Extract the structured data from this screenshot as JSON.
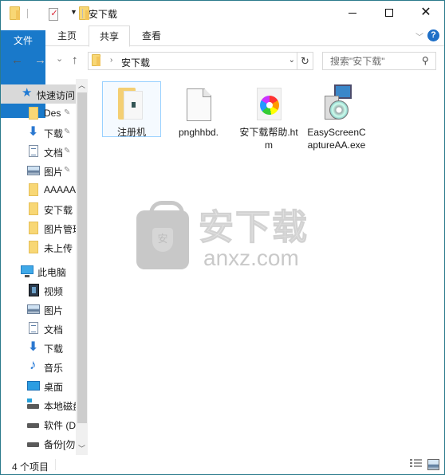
{
  "window": {
    "title": "安下载",
    "controls": {
      "minimize": "minimize",
      "maximize": "maximize",
      "close": "close"
    }
  },
  "quick_access_toolbar": {
    "icons": [
      "folder-icon",
      "properties-icon",
      "new-folder-icon",
      "customize-dropdown-icon"
    ]
  },
  "ribbon": {
    "tabs": [
      {
        "label": "文件"
      },
      {
        "label": "主页"
      },
      {
        "label": "共享",
        "active": true
      },
      {
        "label": "查看"
      }
    ],
    "expand_glyph": "﹀",
    "help_glyph": "?"
  },
  "navigation": {
    "back": "←",
    "forward": "→",
    "recent": "⌄",
    "up": "↑",
    "address": {
      "separator": "›",
      "crumbs": [
        "安下载"
      ],
      "dropdown": "⌄",
      "refresh": "↻"
    },
    "search": {
      "placeholder": "搜索\"安下载\"",
      "value": "",
      "icon": "⚲"
    }
  },
  "sidebar": {
    "quick_access_label": "快速访问",
    "items": [
      {
        "label": "快速访问",
        "icon": "star",
        "group": "header",
        "selected": true
      },
      {
        "label": "Des",
        "icon": "folder",
        "pinned": true
      },
      {
        "label": "下载",
        "icon": "download",
        "pinned": true
      },
      {
        "label": "文档",
        "icon": "document",
        "pinned": true
      },
      {
        "label": "图片",
        "icon": "picture",
        "pinned": true
      },
      {
        "label": "AAAAA",
        "icon": "folder"
      },
      {
        "label": "安下载",
        "icon": "folder"
      },
      {
        "label": "图片管理",
        "icon": "folder"
      },
      {
        "label": "未上传",
        "icon": "folder"
      },
      {
        "label": "此电脑",
        "icon": "computer",
        "group": "header"
      },
      {
        "label": "视频",
        "icon": "video"
      },
      {
        "label": "图片",
        "icon": "picture"
      },
      {
        "label": "文档",
        "icon": "document"
      },
      {
        "label": "下载",
        "icon": "download"
      },
      {
        "label": "音乐",
        "icon": "music"
      },
      {
        "label": "桌面",
        "icon": "desktop"
      },
      {
        "label": "本地磁盘",
        "icon": "system-drive"
      },
      {
        "label": "软件 (D",
        "icon": "drive"
      },
      {
        "label": "备份[勿",
        "icon": "drive"
      }
    ],
    "pin_glyph": "📌",
    "scroll_up": "︿",
    "scroll_down": "﹀"
  },
  "files": [
    {
      "name": "注册机",
      "type": "folder",
      "selected": true
    },
    {
      "name": "pnghhbd.",
      "type": "file"
    },
    {
      "name": "安下载帮助.htm",
      "type": "htm"
    },
    {
      "name": "EasyScreenCaptureAA.exe",
      "type": "exe"
    }
  ],
  "watermark": {
    "cn": "安下载",
    "en": "anxz.com",
    "badge": "安"
  },
  "status": {
    "item_count": "4 个项目"
  }
}
